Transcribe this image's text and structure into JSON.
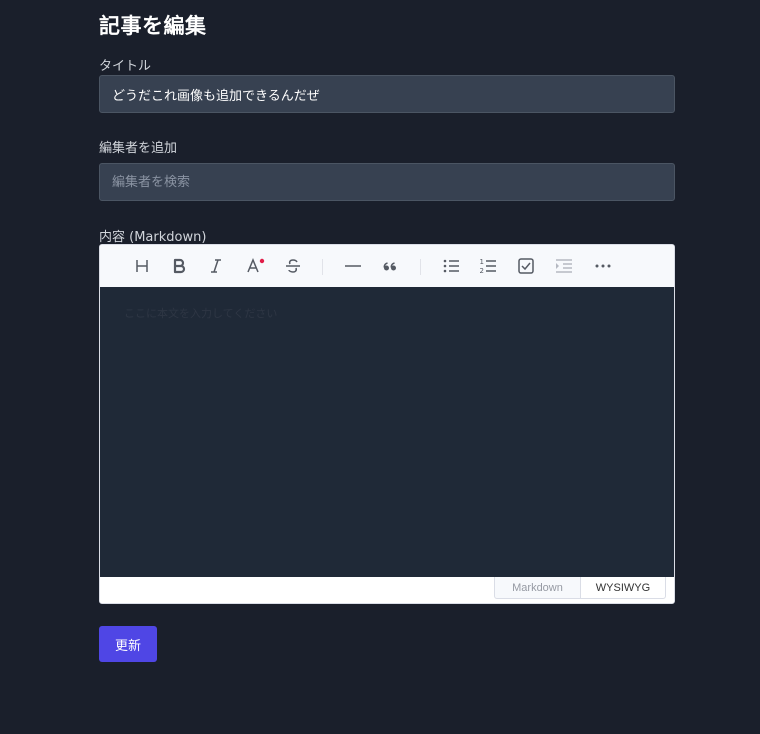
{
  "page": {
    "title": "記事を編集"
  },
  "form": {
    "title_label": "タイトル",
    "title_value": "どうだこれ画像も追加できるんだぜ",
    "editors_label": "編集者を追加",
    "editors_placeholder": "編集者を検索",
    "content_label": "内容 (Markdown)",
    "submit_label": "更新"
  },
  "editor": {
    "toolbar": [
      {
        "name": "heading-icon",
        "tooltip": "Headings"
      },
      {
        "name": "bold-icon",
        "tooltip": "Bold"
      },
      {
        "name": "italic-icon",
        "tooltip": "Italic"
      },
      {
        "name": "text-color-icon",
        "tooltip": "Text color"
      },
      {
        "name": "strikethrough-icon",
        "tooltip": "Strike"
      },
      {
        "name": "horizontal-line-icon",
        "tooltip": "Line"
      },
      {
        "name": "blockquote-icon",
        "tooltip": "Blockquote"
      },
      {
        "name": "bullet-list-icon",
        "tooltip": "Unordered list"
      },
      {
        "name": "ordered-list-icon",
        "tooltip": "Ordered list"
      },
      {
        "name": "task-checkbox-icon",
        "tooltip": "Task"
      },
      {
        "name": "indent-icon",
        "tooltip": "Indent"
      },
      {
        "name": "more-icon",
        "tooltip": "More"
      }
    ],
    "body_placeholder": "ここに本文を入力してください",
    "modes": {
      "markdown": "Markdown",
      "wysiwyg": "WYSIWYG"
    },
    "active_mode": "WYSIWYG"
  },
  "colors": {
    "background": "#1a1f2b",
    "input_bg": "#374151",
    "editor_bg": "#1f2937",
    "accent": "#4f46e5",
    "color_dot": "#e11d48"
  }
}
